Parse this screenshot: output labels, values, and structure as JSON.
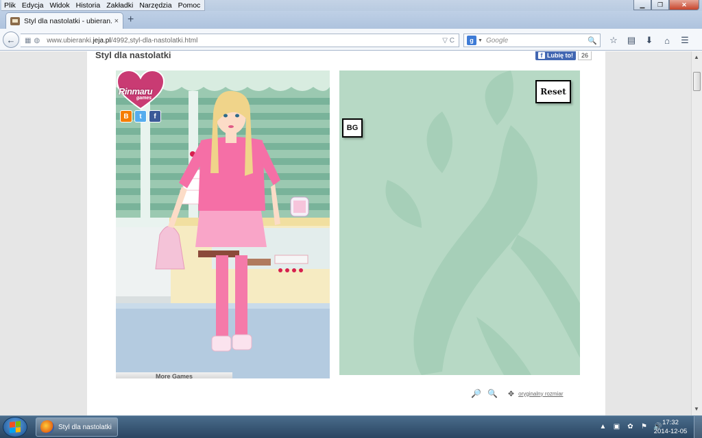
{
  "menu": {
    "items": [
      "Plik",
      "Edycja",
      "Widok",
      "Historia",
      "Zakładki",
      "Narzędzia",
      "Pomoc"
    ]
  },
  "window_controls": {
    "minimize": "▁",
    "maximize": "❐",
    "close": "✕"
  },
  "tab": {
    "title": "Styl dla nastolatki - ubieran...",
    "close": "×",
    "new_tab": "+"
  },
  "navigation": {
    "back": "←",
    "url_prefix": "www.ubieranki.",
    "url_domain": "jeja.pl",
    "url_path": "/4992,styl-dla-nastolatki.html",
    "url_controls": "▽ C"
  },
  "search": {
    "engine_letter": "g",
    "placeholder": "Google",
    "button": "🔍"
  },
  "toolbar": {
    "bookmark": "☆",
    "reading_list": "▤",
    "download": "⬇",
    "home": "⌂",
    "menu": "☰"
  },
  "page": {
    "title": "Styl dla nastolatki",
    "fb_like_label": "Lubię to!",
    "fb_like_count": "26"
  },
  "game": {
    "logo_text": "Rinmaru",
    "logo_sub": "games",
    "share_icons": [
      {
        "name": "blogger-icon",
        "glyph": "B",
        "color": "#f57d00"
      },
      {
        "name": "twitter-icon",
        "glyph": "t",
        "color": "#55acee"
      },
      {
        "name": "facebook-icon",
        "glyph": "f",
        "color": "#3b5998"
      }
    ],
    "more_games": "More Games",
    "reset": "Reset",
    "bg": "BG"
  },
  "below_game": {
    "original_size": "oryginalny rozmiar"
  },
  "taskbar": {
    "firefox_label": "Styl dla nastolatki ...",
    "time": "17:32",
    "date": "2014-12-05"
  },
  "colors": {
    "shop_wall": "#8ec0a7",
    "right_bg": "#b7d9c5",
    "pink_outfit": "#f56fa6",
    "hair": "#f0d48a"
  }
}
